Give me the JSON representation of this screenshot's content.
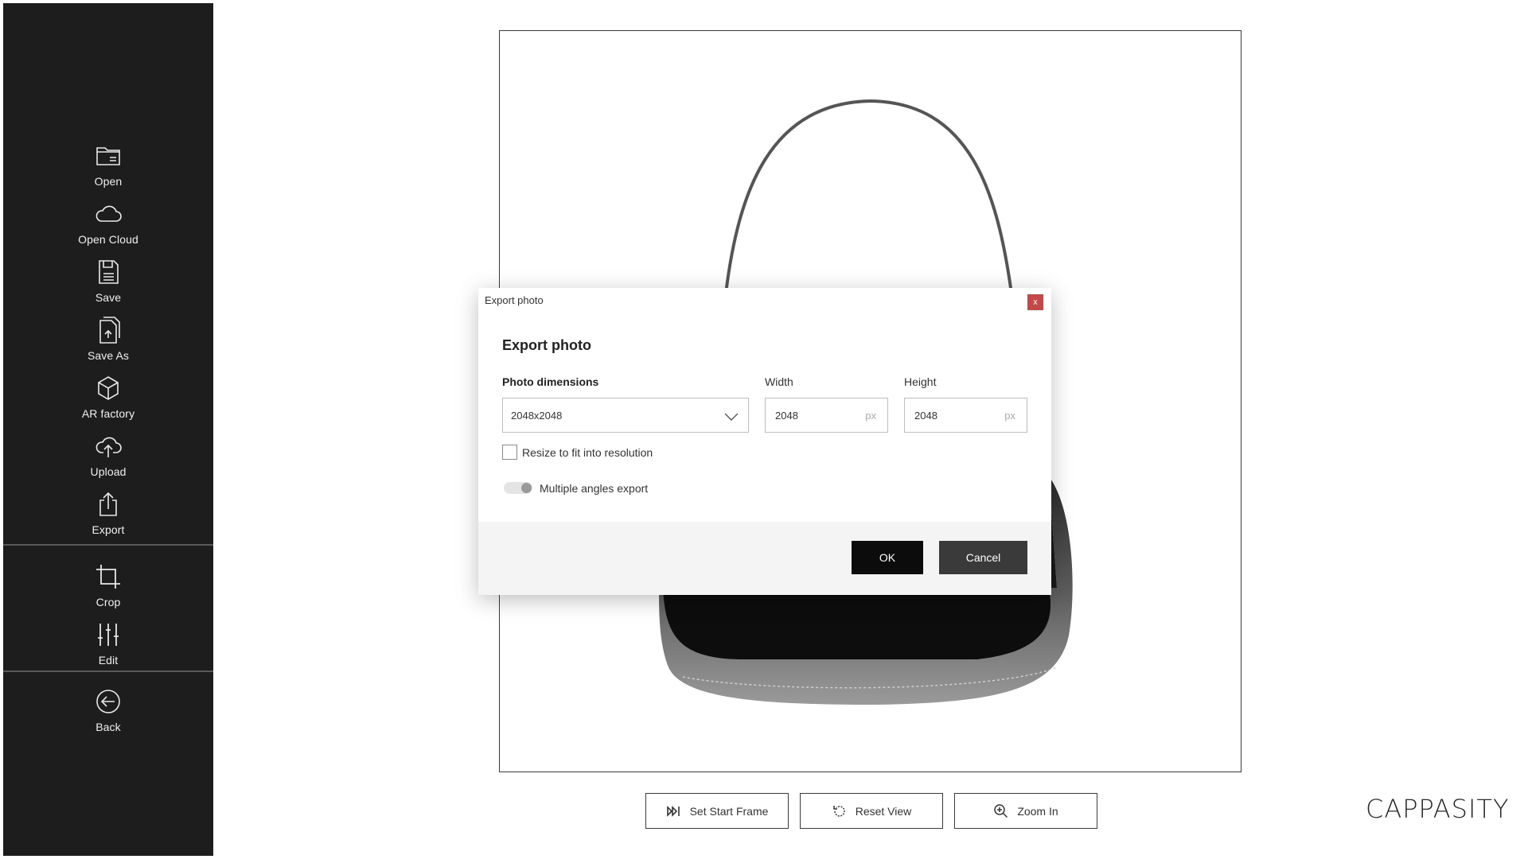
{
  "sidebar": {
    "items": [
      {
        "label": "Open",
        "icon": "folder-icon"
      },
      {
        "label": "Open Cloud",
        "icon": "cloud-icon"
      },
      {
        "label": "Save",
        "icon": "save-icon"
      },
      {
        "label": "Save As",
        "icon": "save-as-icon"
      },
      {
        "label": "AR factory",
        "icon": "cube-icon"
      },
      {
        "label": "Upload",
        "icon": "cloud-upload-icon"
      },
      {
        "label": "Export",
        "icon": "export-icon"
      },
      {
        "label": "Crop",
        "icon": "crop-icon"
      },
      {
        "label": "Edit",
        "icon": "sliders-icon"
      },
      {
        "label": "Back",
        "icon": "back-arrow-icon"
      }
    ]
  },
  "toolbar": {
    "set_start_frame": "Set Start Frame",
    "reset_view": "Reset View",
    "zoom_in": "Zoom In"
  },
  "brand": {
    "logo_text": "CAPPASITY"
  },
  "dialog": {
    "window_title": "Export photo",
    "close_label": "x",
    "heading": "Export photo",
    "dimensions_label": "Photo dimensions",
    "dimensions_value": "2048x2048",
    "width_label": "Width",
    "width_value": "2048",
    "height_label": "Height",
    "height_value": "2048",
    "unit": "px",
    "resize_label": "Resize to fit into resolution",
    "resize_checked": false,
    "multi_angle_label": "Multiple angles export",
    "multi_angle_on": false,
    "ok_label": "OK",
    "cancel_label": "Cancel"
  },
  "colors": {
    "sidebar_bg": "#1d1d1d",
    "close_button": "#c44848",
    "ok_button": "#0c0c0c",
    "cancel_button": "#3a3a3a"
  }
}
